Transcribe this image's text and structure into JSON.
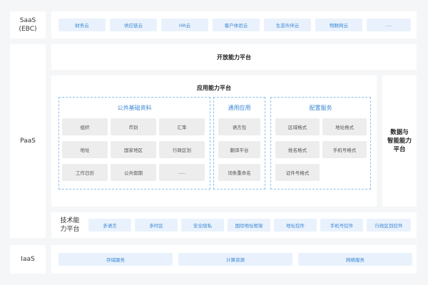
{
  "saas": {
    "label": "SaaS\n(EBC)",
    "items": [
      "财务云",
      "供应链云",
      "HR云",
      "客户体验云",
      "生态伙伴云",
      "物联网云",
      "....."
    ]
  },
  "paas": {
    "label": "PaaS",
    "open_platform": "开放能力平台",
    "app_platform": {
      "title": "应用能力平台",
      "public_data": {
        "title": "公共基础资料",
        "items": [
          "组织",
          "币别",
          "汇率",
          "地址",
          "国家地区",
          "行政区划",
          "工作日历",
          "公共假期",
          "....."
        ]
      },
      "general_app": {
        "title": "通用应用",
        "items": [
          "语言包",
          "翻译平台",
          "词条重命名"
        ]
      },
      "config_service": {
        "title": "配置服务",
        "items": [
          "区域格式",
          "地址格式",
          "姓名格式",
          "手机号格式",
          "证件号格式"
        ]
      }
    },
    "data_ai": "数据与\n智能能力\n平台",
    "tech_platform": {
      "label": "技术能\n力平台",
      "items": [
        "多语言",
        "多时区",
        "安全隐私",
        "国际地址框架",
        "地址控件",
        "手机号控件",
        "行政区划控件"
      ]
    }
  },
  "iaas": {
    "label": "IaaS",
    "items": [
      "存储服务",
      "计算资源",
      "网络服务"
    ]
  }
}
